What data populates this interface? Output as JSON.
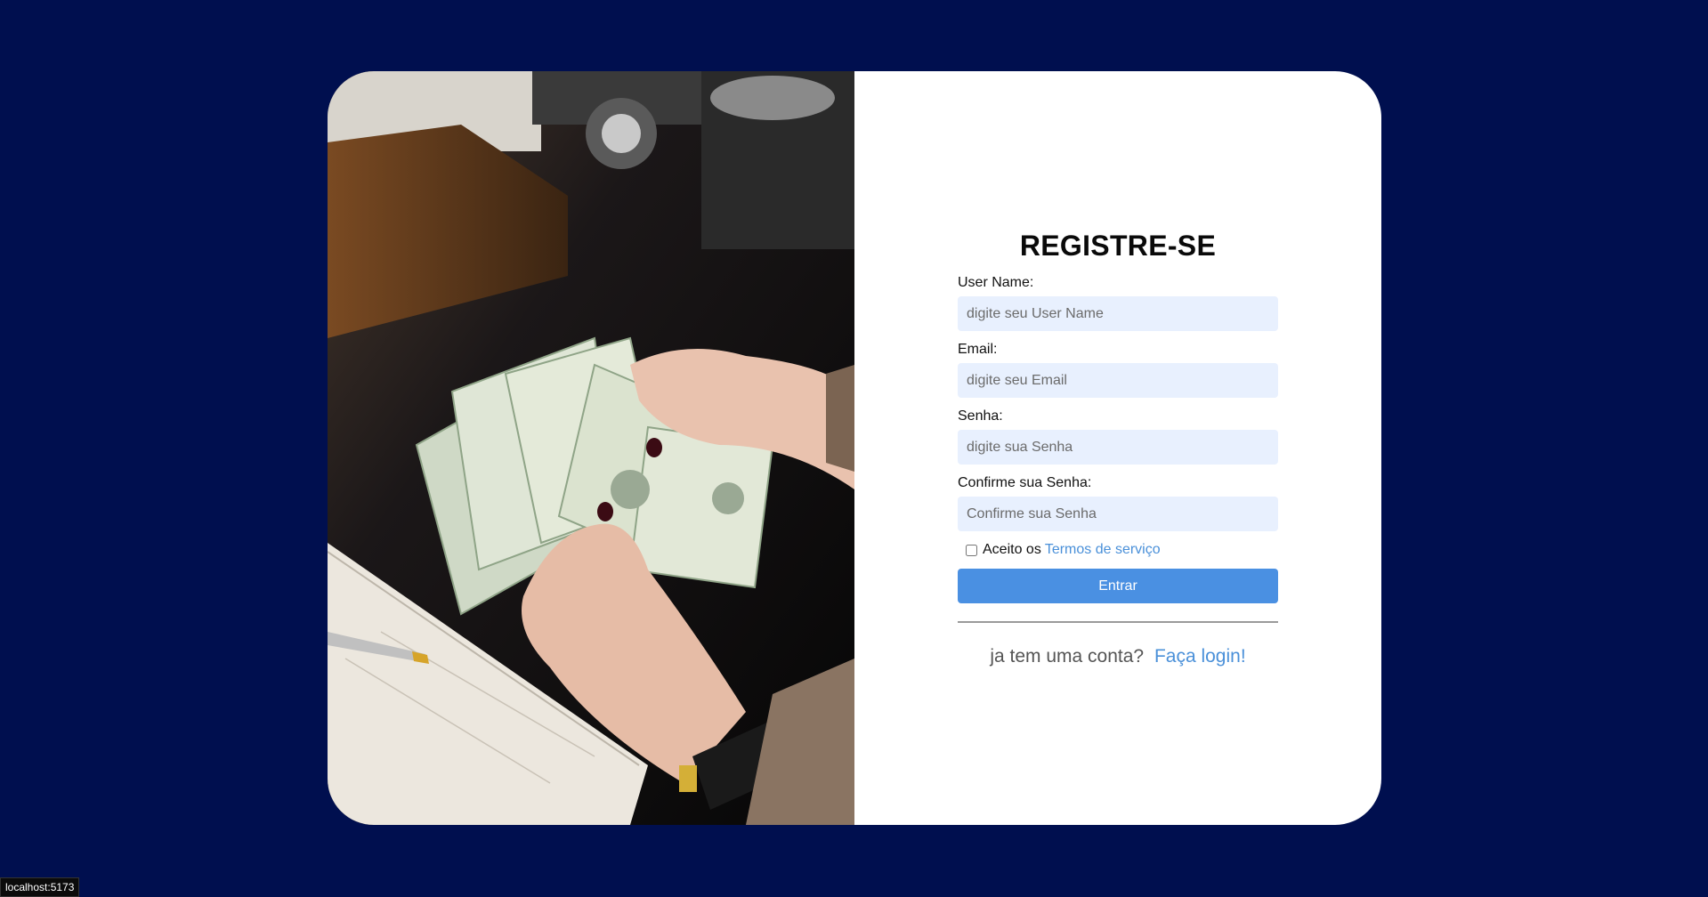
{
  "form": {
    "title": "REGISTRE-SE",
    "username": {
      "label": "User Name:",
      "placeholder": "digite seu User Name"
    },
    "email": {
      "label": "Email:",
      "placeholder": "digite seu Email"
    },
    "password": {
      "label": "Senha:",
      "placeholder": "digite sua Senha"
    },
    "confirm": {
      "label": "Confirme sua Senha:",
      "placeholder": "Confirme sua Senha"
    },
    "terms": {
      "prefix": "Aceito os",
      "link": "Termos de serviço",
      "checked": false
    },
    "submit_label": "Entrar",
    "login_prompt": "ja tem uma conta?",
    "login_link": "Faça login!"
  },
  "status_bar": {
    "url": "localhost:5173"
  },
  "colors": {
    "background": "#000f4f",
    "input_bg": "#e8f0fe",
    "button": "#4a90e2",
    "link": "#4a90d9"
  },
  "image": {
    "subject": "hands counting dollar bills over a notebook"
  }
}
